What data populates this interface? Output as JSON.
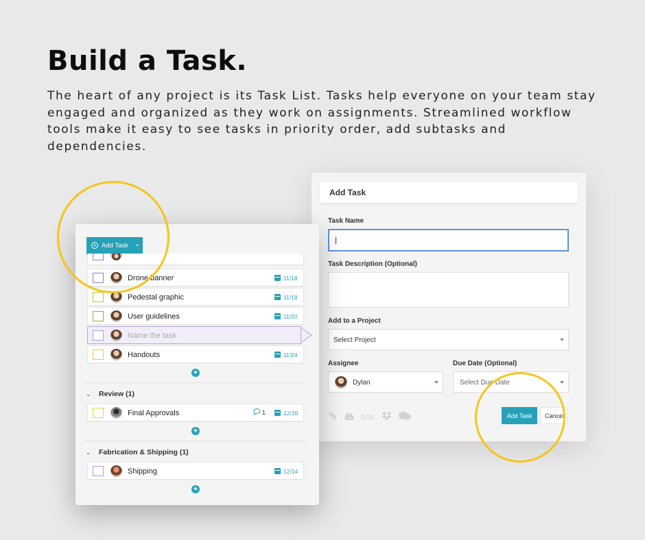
{
  "headline": "Build a Task.",
  "intro": "The heart of any project is its Task List. Tasks help everyone on your team stay engaged and organized as they work on assignments. Streamlined workflow tools make it easy to see tasks in priority order, add subtasks and dependencies.",
  "task_list": {
    "add_button_label": "Add Task",
    "tasks": [
      {
        "name": "Drone banner",
        "date": "11/18",
        "checkbox_color": "#8d7ed8"
      },
      {
        "name": "Pedestal graphic",
        "date": "11/18",
        "checkbox_color": "#b8c832"
      },
      {
        "name": "User guidelines",
        "date": "11/20",
        "checkbox_color": "#8cb534"
      },
      {
        "name": "Handouts",
        "date": "11/24",
        "checkbox_color": "#f4c430"
      }
    ],
    "new_task_placeholder": "Name the task",
    "sections": [
      {
        "title": "Review (1)",
        "tasks": [
          {
            "name": "Final Approvals",
            "comments": "1",
            "date": "12/10",
            "checkbox_color": "#f4d430"
          }
        ]
      },
      {
        "title": "Fabrication & Shipping (1)",
        "tasks": [
          {
            "name": "Shipping",
            "date": "12/14",
            "checkbox_color": "#a99be3"
          }
        ]
      }
    ]
  },
  "add_task_form": {
    "title": "Add Task",
    "task_name_label": "Task Name",
    "task_name_value": "|",
    "description_label": "Task Description (Optional)",
    "project_label": "Add to a Project",
    "project_value": "Select Project",
    "assignee_label": "Assignee",
    "assignee_value": "Dylan",
    "due_date_label": "Due Date (Optional)",
    "due_date_value": "Select Due Date",
    "attachment_icons": [
      "paperclip-icon",
      "google-drive-icon",
      "box-icon",
      "dropbox-icon",
      "chat-icon"
    ],
    "box_label": "box",
    "submit_label": "Add Task",
    "cancel_label": "Cancel"
  },
  "colors": {
    "accent": "#27a1b8",
    "highlight_ring": "#f5c518",
    "focus_border": "#5a93d8"
  }
}
